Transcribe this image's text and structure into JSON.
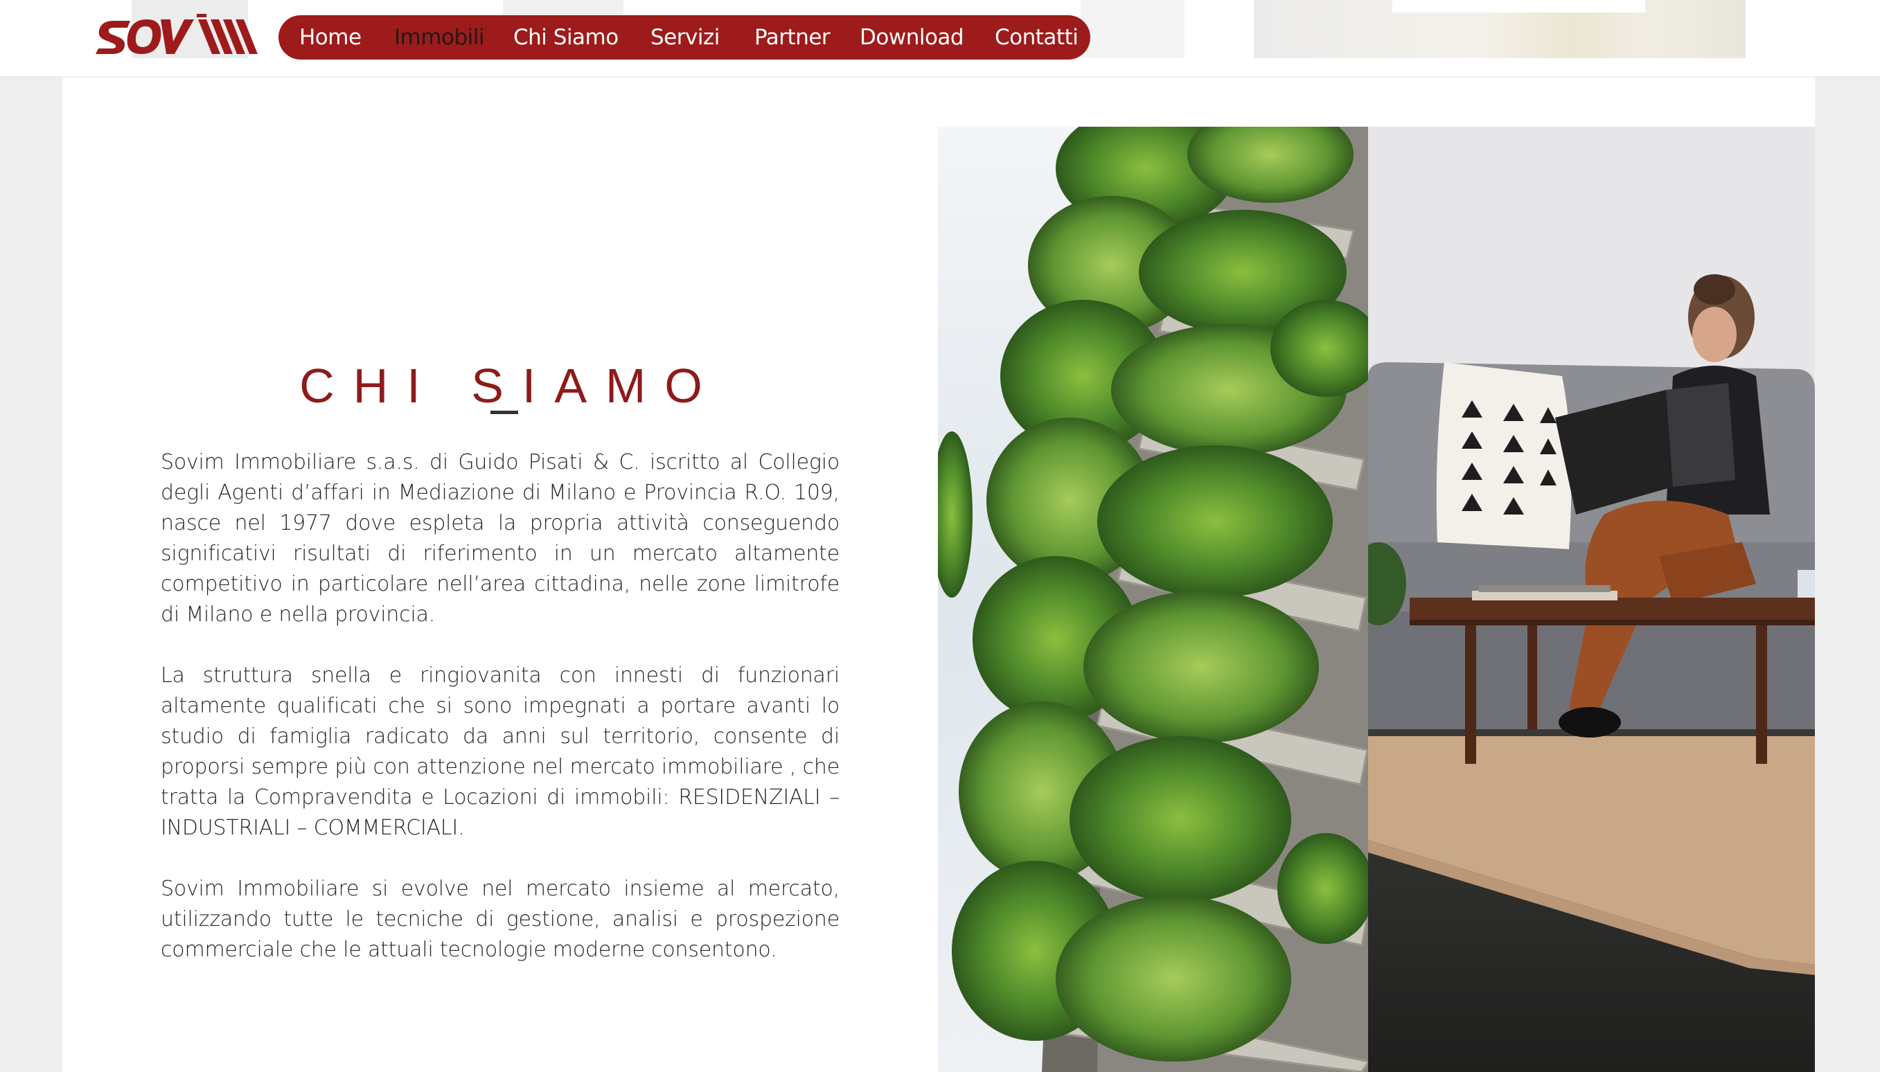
{
  "brand": {
    "logo_text": "sovim",
    "brand_color": "#9e1b1b"
  },
  "nav": {
    "items": [
      {
        "label": "Home",
        "active": false
      },
      {
        "label": "Immobili",
        "active": true
      },
      {
        "label": "Chi Siamo",
        "active": false
      },
      {
        "label": "Servizi",
        "active": false
      },
      {
        "label": "Partner",
        "active": false
      },
      {
        "label": "Download",
        "active": false
      },
      {
        "label": "Contatti",
        "active": false
      }
    ]
  },
  "about": {
    "title": "CHI SIAMO",
    "paragraphs": [
      "Sovim Immobiliare s.a.s. di Guido Pisati & C. iscritto al Collegio degli Agenti d’affari in Mediazione di Milano e Provincia R.O. 109, nasce nel 1977 dove espleta la propria attività conseguendo significativi risultati di riferimento in un mercato altamente competitivo in particolare nell’area cittadina, nelle zone limitrofe di Milano e nella provincia.",
      "La struttura snella e ringiovanita con innesti di funzionari altamente qualificati che si sono impegnati a portare avanti lo studio di famiglia radicato da anni sul territorio, consente di proporsi sempre più con attenzione nel mercato immobiliare , che tratta la Compravendita e Locazioni di immobili: RESIDENZIALI – INDUSTRIALI – COMMERCIALI.",
      "Sovim Immobiliare si evolve nel mercato insieme al mercato, utilizzando tutte le tecniche di gestione, analisi e prospezione commerciale che le attuali tecnologie moderne consentono."
    ]
  },
  "colors": {
    "title": "#8e1a1a",
    "text": "#262626",
    "page_bg": "#efefef"
  }
}
